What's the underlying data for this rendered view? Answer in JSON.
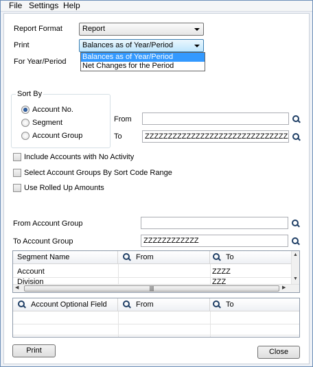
{
  "menu": {
    "file": "File",
    "settings": "Settings",
    "help": "Help"
  },
  "report_format": {
    "label": "Report Format",
    "value": "Report"
  },
  "print_option": {
    "label": "Print",
    "value": "Balances as of Year/Period",
    "options": [
      "Balances as of Year/Period",
      "Net Changes for the Period"
    ]
  },
  "year_period_label": "For Year/Period",
  "sort_by": {
    "title": "Sort By",
    "options": [
      "Account No.",
      "Segment",
      "Account Group"
    ],
    "selected": "Account No.",
    "from_label": "From",
    "to_label": "To",
    "from_value": "",
    "to_value": "ZZZZZZZZZZZZZZZZZZZZZZZZZZZZZZZZZZZZZZZZZZZZ"
  },
  "checkboxes": [
    {
      "label": "Include Accounts with No Activity",
      "checked": false
    },
    {
      "label": "Select Account Groups By Sort Code Range",
      "checked": false
    },
    {
      "label": "Use Rolled Up Amounts",
      "checked": false
    }
  ],
  "account_group": {
    "from_label": "From Account Group",
    "from_value": "",
    "to_label": "To Account Group",
    "to_value": "ZZZZZZZZZZZZ"
  },
  "segment_grid": {
    "headers": [
      "Segment Name",
      "From",
      "To"
    ],
    "rows": [
      {
        "name": "Account",
        "from": "",
        "to": "ZZZZ"
      },
      {
        "name": "Division",
        "from": "",
        "to": "ZZZ"
      }
    ]
  },
  "optional_grid": {
    "headers": [
      "Account Optional Field",
      "From",
      "To"
    ],
    "rows": []
  },
  "buttons": {
    "print": "Print",
    "close": "Close"
  }
}
